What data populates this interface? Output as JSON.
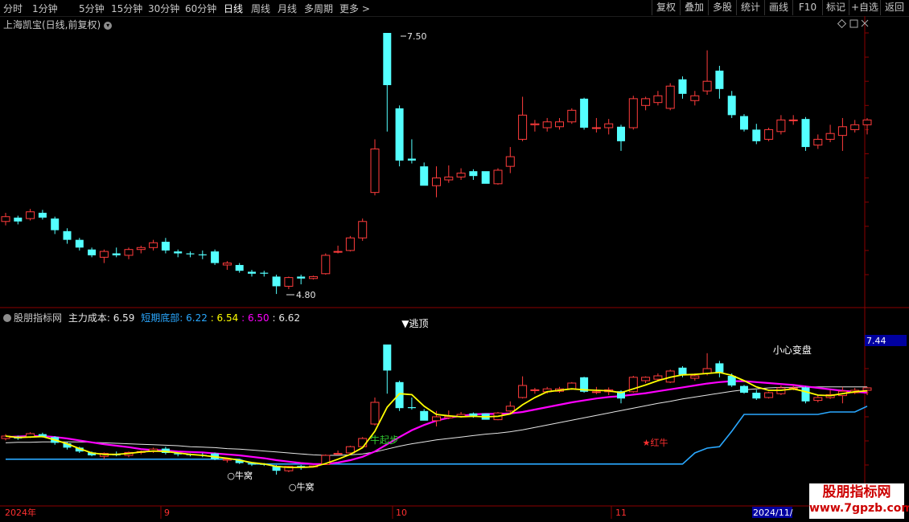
{
  "toolbar": {
    "periods": [
      "分时",
      "1分钟",
      "5分钟",
      "15分钟",
      "30分钟",
      "60分钟",
      "日线",
      "周线",
      "月线",
      "多周期",
      "更多 >"
    ],
    "active_period": "日线",
    "right_buttons": [
      "复权",
      "叠加",
      "多股",
      "统计",
      "画线",
      "F10",
      "标记",
      "+自选",
      "返回"
    ]
  },
  "main_panel": {
    "title": "上海凯宝(日线,前复权)",
    "price_ticks": [
      "7.50",
      "7.25",
      "7.00",
      "6.75",
      "6.50",
      "6.25",
      "6.00",
      "5.75",
      "5.50",
      "5.25",
      "5.00"
    ],
    "high_label": "7.50",
    "low_label": "4.80",
    "icons": [
      "diamond-icon",
      "window-icon",
      "close-icon"
    ]
  },
  "indicator_panel": {
    "name": "股朋指标网",
    "main_cost_label": "主力成本:",
    "main_cost_value": "6.59",
    "short_bottom_label": "短期底部:",
    "short_bottom_value": "6.22",
    "yellow_value": ": 6.54",
    "magenta_value": ": 6.50",
    "white_value": ": 6.62",
    "right_value_box": "7.44",
    "ticks": [
      "7.00",
      "6.50",
      "6.00",
      "5.50",
      "5.00"
    ],
    "annotations": {
      "escape": "▼逃顶",
      "bull_start": "牛起步",
      "nest1": "○牛窝",
      "nest2": "○牛窝",
      "red_bull": "★红牛",
      "careful": "小心变盘"
    }
  },
  "date_axis": {
    "labels": [
      "2024年",
      "9",
      "10",
      "11",
      "2024/11/"
    ]
  },
  "watermark": {
    "line1": "股朋指标网",
    "line2": "www.7gpzb.com"
  },
  "colors": {
    "up": "#ff3c3c",
    "down": "#54ffff",
    "ma_yellow": "#ffff00",
    "ma_magenta": "#ff00ff",
    "ma_white": "#e6e6e6",
    "bottom_line": "#2aa8ff",
    "axis": "#8b0000"
  },
  "chart_data": {
    "type": "candlestick",
    "candles": [
      [
        5.55,
        5.64,
        5.51,
        5.6
      ],
      [
        5.59,
        5.61,
        5.52,
        5.55
      ],
      [
        5.58,
        5.68,
        5.56,
        5.65
      ],
      [
        5.64,
        5.67,
        5.57,
        5.59
      ],
      [
        5.58,
        5.6,
        5.42,
        5.46
      ],
      [
        5.45,
        5.48,
        5.32,
        5.36
      ],
      [
        5.36,
        5.38,
        5.25,
        5.28
      ],
      [
        5.26,
        5.28,
        5.18,
        5.2
      ],
      [
        5.18,
        5.26,
        5.12,
        5.24
      ],
      [
        5.22,
        5.28,
        5.18,
        5.2
      ],
      [
        5.2,
        5.28,
        5.16,
        5.26
      ],
      [
        5.26,
        5.3,
        5.22,
        5.28
      ],
      [
        5.28,
        5.36,
        5.25,
        5.33
      ],
      [
        5.34,
        5.38,
        5.22,
        5.25
      ],
      [
        5.24,
        5.26,
        5.18,
        5.22
      ],
      [
        5.22,
        5.24,
        5.18,
        5.21
      ],
      [
        5.21,
        5.25,
        5.16,
        5.2
      ],
      [
        5.24,
        5.26,
        5.1,
        5.12
      ],
      [
        5.1,
        5.14,
        5.05,
        5.12
      ],
      [
        5.1,
        5.12,
        5.02,
        5.04
      ],
      [
        5.03,
        5.05,
        4.98,
        5.01
      ],
      [
        5.02,
        5.04,
        4.98,
        5.01
      ],
      [
        4.98,
        5.0,
        4.8,
        4.88
      ],
      [
        4.88,
        4.98,
        4.85,
        4.97
      ],
      [
        4.98,
        5.0,
        4.9,
        4.96
      ],
      [
        4.96,
        4.99,
        4.95,
        4.98
      ],
      [
        5.01,
        5.22,
        5.0,
        5.2
      ],
      [
        5.24,
        5.3,
        5.22,
        5.24
      ],
      [
        5.25,
        5.4,
        5.24,
        5.38
      ],
      [
        5.38,
        5.58,
        5.35,
        5.55
      ],
      [
        5.85,
        6.4,
        5.82,
        6.3
      ],
      [
        7.5,
        7.5,
        6.48,
        6.96
      ],
      [
        6.72,
        6.75,
        6.12,
        6.18
      ],
      [
        6.2,
        6.4,
        6.15,
        6.18
      ],
      [
        6.12,
        6.16,
        5.95,
        5.92
      ],
      [
        5.92,
        6.12,
        5.8,
        6.0
      ],
      [
        5.98,
        6.13,
        5.95,
        6.01
      ],
      [
        6.01,
        6.1,
        5.98,
        6.05
      ],
      [
        6.07,
        6.09,
        5.98,
        6.02
      ],
      [
        6.07,
        6.05,
        5.98,
        5.94
      ],
      [
        5.94,
        6.1,
        5.93,
        6.08
      ],
      [
        6.12,
        6.32,
        6.05,
        6.22
      ],
      [
        6.4,
        6.84,
        6.38,
        6.65
      ],
      [
        6.55,
        6.6,
        6.48,
        6.56
      ],
      [
        6.52,
        6.62,
        6.48,
        6.58
      ],
      [
        6.53,
        6.62,
        6.5,
        6.58
      ],
      [
        6.58,
        6.72,
        6.56,
        6.7
      ],
      [
        6.82,
        6.83,
        6.5,
        6.52
      ],
      [
        6.52,
        6.62,
        6.47,
        6.52
      ],
      [
        6.52,
        6.61,
        6.45,
        6.56
      ],
      [
        6.53,
        6.55,
        6.28,
        6.38
      ],
      [
        6.52,
        6.85,
        6.5,
        6.82
      ],
      [
        6.75,
        6.84,
        6.7,
        6.82
      ],
      [
        6.78,
        6.9,
        6.75,
        6.85
      ],
      [
        6.72,
        6.98,
        6.7,
        6.95
      ],
      [
        7.02,
        7.05,
        6.82,
        6.87
      ],
      [
        6.8,
        6.9,
        6.75,
        6.85
      ],
      [
        6.9,
        7.32,
        6.86,
        7.0
      ],
      [
        7.11,
        7.16,
        6.82,
        6.92
      ],
      [
        6.85,
        6.9,
        6.62,
        6.65
      ],
      [
        6.64,
        6.66,
        6.48,
        6.5
      ],
      [
        6.5,
        6.56,
        6.35,
        6.38
      ],
      [
        6.4,
        6.52,
        6.38,
        6.5
      ],
      [
        6.48,
        6.65,
        6.45,
        6.6
      ],
      [
        6.6,
        6.65,
        6.55,
        6.6
      ],
      [
        6.61,
        6.63,
        6.28,
        6.32
      ],
      [
        6.34,
        6.45,
        6.3,
        6.4
      ],
      [
        6.4,
        6.55,
        6.37,
        6.46
      ],
      [
        6.44,
        6.62,
        6.28,
        6.53
      ],
      [
        6.5,
        6.6,
        6.47,
        6.55
      ],
      [
        6.55,
        6.62,
        6.45,
        6.6
      ]
    ],
    "ohlc_order": [
      "open",
      "high",
      "low",
      "close"
    ],
    "ylim": [
      4.7,
      7.6
    ],
    "indicator_ylim": [
      4.75,
      7.45
    ],
    "series": [
      {
        "key": "yellow",
        "values": [
          5.6,
          5.57,
          5.58,
          5.59,
          5.52,
          5.44,
          5.34,
          5.25,
          5.22,
          5.22,
          5.24,
          5.27,
          5.29,
          5.28,
          5.25,
          5.22,
          5.2,
          5.17,
          5.14,
          5.1,
          5.05,
          5.02,
          4.97,
          4.95,
          4.95,
          4.96,
          5.03,
          5.12,
          5.22,
          5.36,
          5.7,
          6.2,
          6.48,
          6.46,
          6.22,
          6.05,
          6.02,
          6.0,
          6.01,
          6.0,
          6.01,
          6.06,
          6.25,
          6.4,
          6.52,
          6.55,
          6.58,
          6.56,
          6.55,
          6.54,
          6.5,
          6.58,
          6.66,
          6.75,
          6.82,
          6.87,
          6.88,
          6.9,
          6.92,
          6.86,
          6.75,
          6.62,
          6.55,
          6.55,
          6.58,
          6.52,
          6.45,
          6.44,
          6.48,
          6.52,
          6.54
        ]
      },
      {
        "key": "magenta",
        "values": [
          5.58,
          5.59,
          5.6,
          5.6,
          5.58,
          5.55,
          5.51,
          5.47,
          5.43,
          5.4,
          5.37,
          5.33,
          5.31,
          5.3,
          5.28,
          5.27,
          5.26,
          5.24,
          5.22,
          5.2,
          5.17,
          5.14,
          5.1,
          5.07,
          5.04,
          5.02,
          5.02,
          5.05,
          5.1,
          5.17,
          5.28,
          5.43,
          5.58,
          5.72,
          5.83,
          5.92,
          5.98,
          6.02,
          6.05,
          6.06,
          6.06,
          6.07,
          6.1,
          6.15,
          6.2,
          6.25,
          6.3,
          6.34,
          6.38,
          6.41,
          6.43,
          6.46,
          6.49,
          6.53,
          6.57,
          6.61,
          6.65,
          6.69,
          6.72,
          6.74,
          6.74,
          6.72,
          6.7,
          6.68,
          6.66,
          6.63,
          6.6,
          6.57,
          6.54,
          6.52,
          6.5
        ]
      },
      {
        "key": "white",
        "values": [
          5.46,
          5.47,
          5.47,
          5.48,
          5.48,
          5.48,
          5.48,
          5.47,
          5.46,
          5.45,
          5.44,
          5.43,
          5.42,
          5.41,
          5.4,
          5.38,
          5.37,
          5.36,
          5.34,
          5.33,
          5.31,
          5.29,
          5.27,
          5.25,
          5.23,
          5.21,
          5.2,
          5.2,
          5.21,
          5.23,
          5.27,
          5.33,
          5.39,
          5.44,
          5.48,
          5.52,
          5.55,
          5.58,
          5.61,
          5.64,
          5.66,
          5.69,
          5.73,
          5.78,
          5.83,
          5.88,
          5.93,
          5.98,
          6.03,
          6.08,
          6.13,
          6.18,
          6.23,
          6.28,
          6.32,
          6.37,
          6.41,
          6.45,
          6.49,
          6.53,
          6.56,
          6.58,
          6.6,
          6.61,
          6.61,
          6.62,
          6.62,
          6.62,
          6.62,
          6.62,
          6.62
        ]
      },
      {
        "key": "bottom",
        "values": [
          5.12,
          5.12,
          5.12,
          5.12,
          5.12,
          5.12,
          5.12,
          5.12,
          5.12,
          5.12,
          5.12,
          5.12,
          5.12,
          5.12,
          5.12,
          5.12,
          5.12,
          5.12,
          5.12,
          5.12,
          5.02,
          5.02,
          5.02,
          5.02,
          5.02,
          5.02,
          5.02,
          5.02,
          5.02,
          5.02,
          5.02,
          5.02,
          5.02,
          5.02,
          5.02,
          5.02,
          5.02,
          5.02,
          5.02,
          5.02,
          5.02,
          5.02,
          5.02,
          5.02,
          5.02,
          5.02,
          5.02,
          5.02,
          5.02,
          5.02,
          5.02,
          5.02,
          5.02,
          5.02,
          5.02,
          5.02,
          5.25,
          5.35,
          5.38,
          5.7,
          6.05,
          6.05,
          6.05,
          6.05,
          6.05,
          6.05,
          6.05,
          6.1,
          6.1,
          6.1,
          6.22
        ]
      }
    ],
    "markers": [
      {
        "type": "escape",
        "index": 31
      },
      {
        "type": "bull_start",
        "index": 30
      },
      {
        "type": "nest1",
        "index": 18
      },
      {
        "type": "nest2",
        "index": 23
      },
      {
        "type": "red_bull",
        "index": 52
      },
      {
        "type": "careful",
        "index": 63
      }
    ]
  }
}
